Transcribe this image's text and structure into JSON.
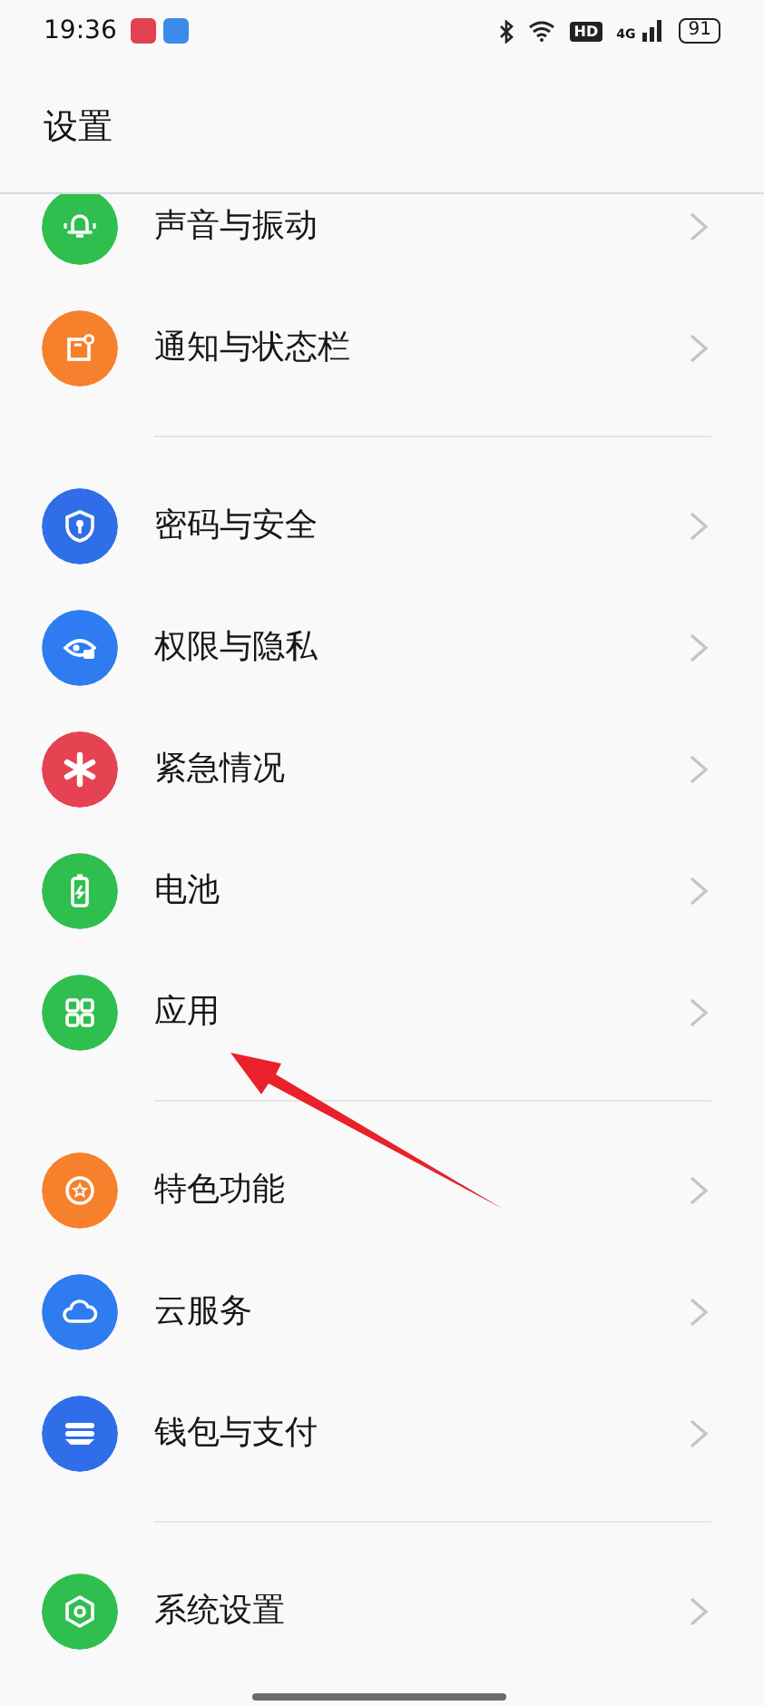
{
  "status_bar": {
    "time": "19:36",
    "hd": "HD",
    "network": "4G",
    "battery": "91"
  },
  "title": "设置",
  "groups": [
    {
      "items": [
        {
          "label": "声音与振动",
          "color": "#2fbf4f"
        },
        {
          "label": "通知与状态栏",
          "color": "#f7802c"
        }
      ]
    },
    {
      "items": [
        {
          "label": "密码与安全",
          "color": "#2f6ee8"
        },
        {
          "label": "权限与隐私",
          "color": "#2e7cf0"
        },
        {
          "label": "紧急情况",
          "color": "#e54352"
        },
        {
          "label": "电池",
          "color": "#2fbf4f"
        },
        {
          "label": "应用",
          "color": "#2fbf4f"
        }
      ]
    },
    {
      "items": [
        {
          "label": "特色功能",
          "color": "#f7802c"
        },
        {
          "label": "云服务",
          "color": "#2e7cf0"
        },
        {
          "label": "钱包与支付",
          "color": "#2f6ee8"
        }
      ]
    },
    {
      "items": [
        {
          "label": "系统设置",
          "color": "#2fbf4f"
        }
      ]
    }
  ]
}
